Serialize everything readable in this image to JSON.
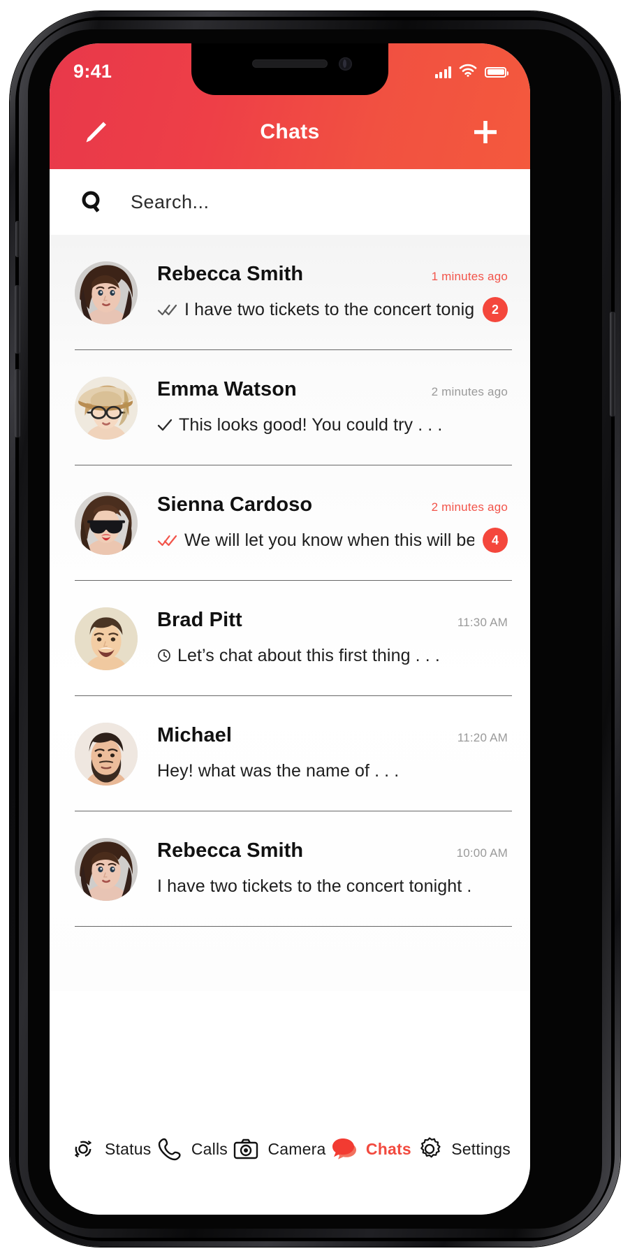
{
  "device": {
    "type": "smartphone-mockup"
  },
  "status_bar": {
    "time": "9:41",
    "signal_icon": "cellular-signal-icon",
    "wifi_icon": "wifi-icon",
    "battery_icon": "battery-full-icon"
  },
  "header": {
    "title": "Chats",
    "compose_icon": "pencil-compose-icon",
    "add_icon": "plus-icon",
    "gradient_from": "#e8384a",
    "gradient_to": "#f4593d"
  },
  "search": {
    "placeholder": "Search...",
    "icon": "search-icon"
  },
  "theme": {
    "accent": "#f2544a",
    "badge_bg": "#f4473c",
    "read_time": "#9a9a9a",
    "unread_time": "#f2544a"
  },
  "chats": [
    {
      "name": "Rebecca Smith",
      "time": "1 minutes ago",
      "time_state": "unread",
      "preview": "I have two tickets to the concert tonight . . .",
      "status_icon": "double-check-read-icon",
      "status_color": "#5a5a5a",
      "badge": "2",
      "avatar": "woman-brown-wavy-hair"
    },
    {
      "name": "Emma Watson",
      "time": "2 minutes ago",
      "time_state": "read",
      "preview": "This looks good! You could try . . .",
      "status_icon": "single-check-icon",
      "status_color": "#2b2b2b",
      "badge": "",
      "avatar": "woman-hat-glasses"
    },
    {
      "name": "Sienna Cardoso",
      "time": "2 minutes ago",
      "time_state": "unread",
      "preview": "We will let you know when this will be . . .",
      "status_icon": "double-check-read-icon",
      "status_color": "#f2544a",
      "badge": "4",
      "avatar": "woman-sunglasses-red-lips"
    },
    {
      "name": "Brad Pitt",
      "time": "11:30 AM",
      "time_state": "read",
      "preview": "Let’s chat about this first thing . . .",
      "status_icon": "clock-pending-icon",
      "status_color": "#2b2b2b",
      "badge": "",
      "avatar": "man-smiling-short-hair"
    },
    {
      "name": "Michael",
      "time": "11:20 AM",
      "time_state": "read",
      "preview": "Hey! what was the name of . . .",
      "status_icon": "none",
      "status_color": "",
      "badge": "",
      "avatar": "man-beard-dark-hair"
    },
    {
      "name": "Rebecca Smith",
      "time": "10:00 AM",
      "time_state": "read",
      "preview": "I have two tickets to the concert tonight . . .",
      "status_icon": "none",
      "status_color": "",
      "badge": "",
      "avatar": "woman-brown-wavy-hair"
    }
  ],
  "tabs": [
    {
      "label": "Status",
      "icon": "status-rings-icon",
      "active": false
    },
    {
      "label": "Calls",
      "icon": "phone-icon",
      "active": false
    },
    {
      "label": "Camera",
      "icon": "camera-icon",
      "active": false
    },
    {
      "label": "Chats",
      "icon": "chat-bubbles-icon",
      "active": true
    },
    {
      "label": "Settings",
      "icon": "gear-icon",
      "active": false
    }
  ]
}
